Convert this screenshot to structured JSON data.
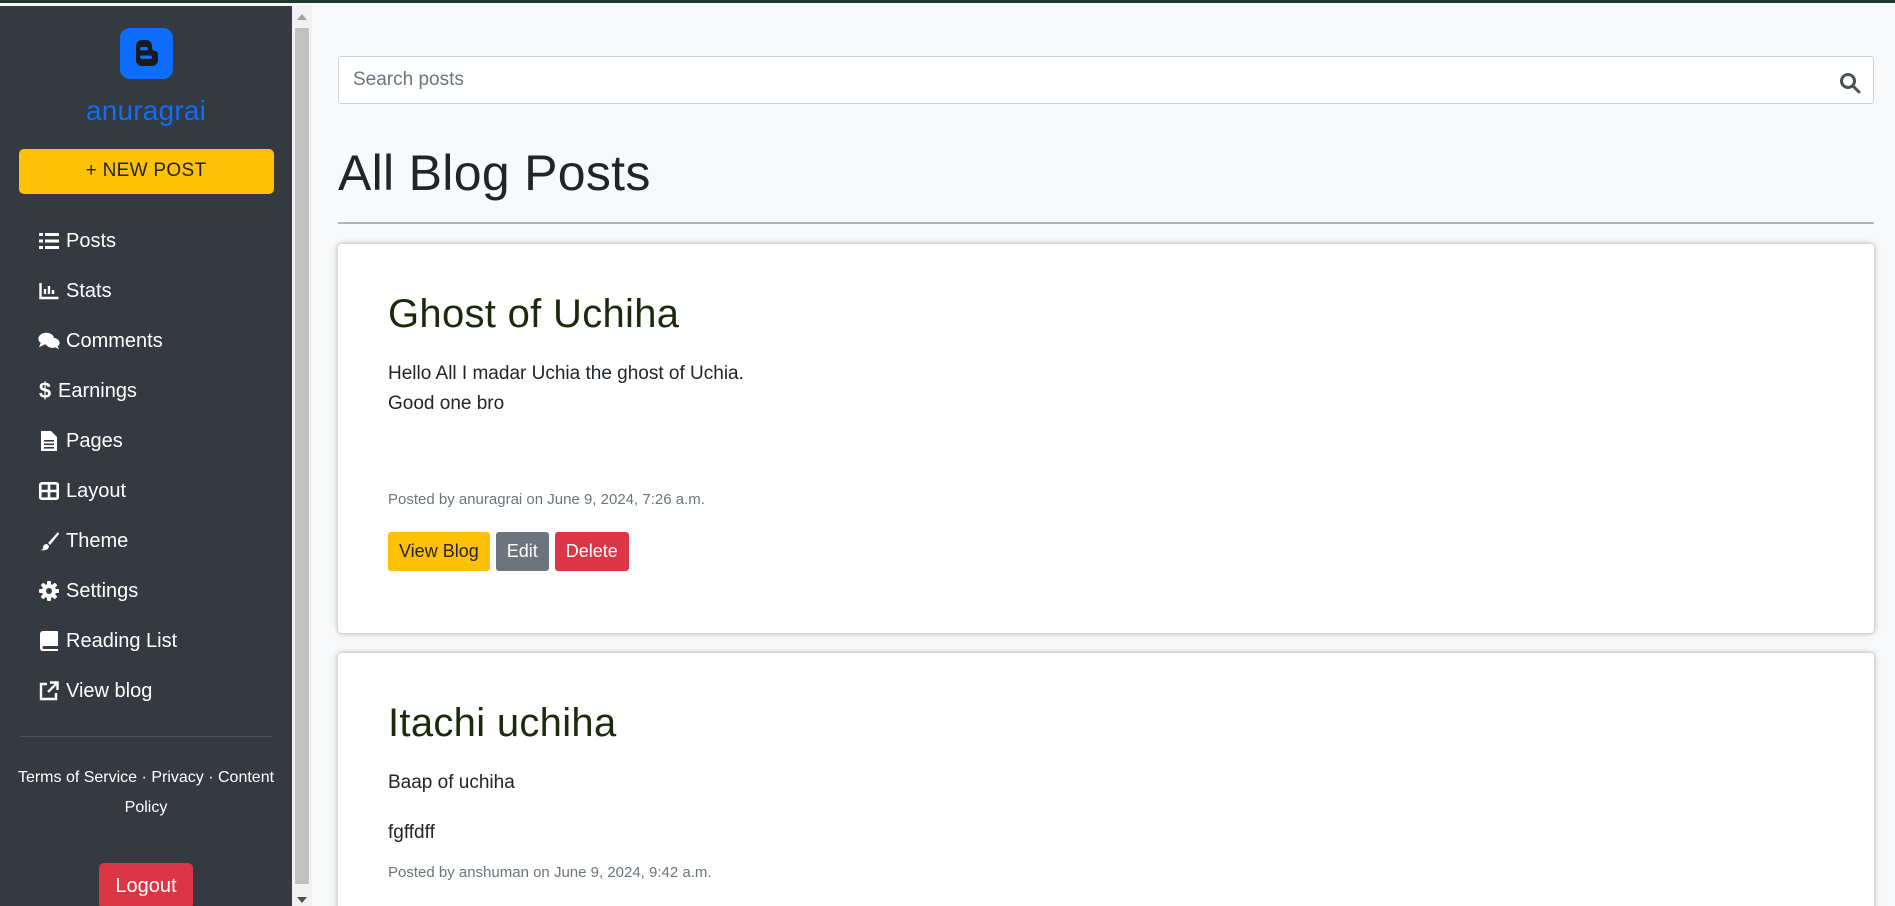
{
  "sidebar": {
    "brand": "anuragrai",
    "new_post_label": "+ NEW POST",
    "items": [
      {
        "label": "Posts",
        "icon": "list-icon"
      },
      {
        "label": "Stats",
        "icon": "chart-line-icon"
      },
      {
        "label": "Comments",
        "icon": "comments-icon"
      },
      {
        "label": "Earnings",
        "icon": "dollar-icon"
      },
      {
        "label": "Pages",
        "icon": "file-icon"
      },
      {
        "label": "Layout",
        "icon": "grid-icon"
      },
      {
        "label": "Theme",
        "icon": "brush-icon"
      },
      {
        "label": "Settings",
        "icon": "gear-icon"
      },
      {
        "label": "Reading List",
        "icon": "book-icon"
      },
      {
        "label": "View blog",
        "icon": "external-link-icon"
      }
    ],
    "footer": {
      "terms": "Terms of Service",
      "privacy": "Privacy",
      "content_policy": "Content Policy",
      "separator": "·"
    },
    "logout_label": "Logout"
  },
  "search": {
    "placeholder": "Search posts",
    "value": ""
  },
  "page_title": "All Blog Posts",
  "posts": [
    {
      "title": "Ghost of Uchiha",
      "body_lines": [
        "Hello All I madar Uchia the ghost of Uchia.",
        "Good one bro"
      ],
      "meta": "Posted by anuragrai on June 9, 2024, 7:26 a.m.",
      "view_label": "View Blog",
      "edit_label": "Edit",
      "delete_label": "Delete"
    },
    {
      "title": "Itachi uchiha",
      "body_lines": [
        "Baap of uchiha",
        "fgffdff"
      ],
      "meta": "Posted by anshuman on June 9, 2024, 9:42 a.m."
    }
  ],
  "colors": {
    "sidebar_bg": "#343a40",
    "brand": "#0d6efd",
    "new_post": "#ffc107",
    "danger": "#dc3545",
    "secondary": "#6c757d"
  }
}
